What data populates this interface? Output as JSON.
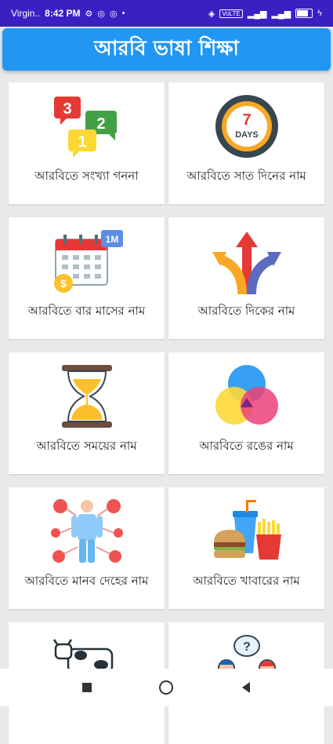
{
  "status_bar": {
    "carrier": "Virgin..",
    "time": "8:42 PM",
    "volte": "VoLTE"
  },
  "app": {
    "title": "আরবি ভাষা শিক্ষা",
    "accent_color": "#2196f3",
    "status_color": "#3a1fc2"
  },
  "cards": [
    {
      "label": "আরবিতে সংখ্যা গননা",
      "icon": "numbers-chat-icon",
      "icon_text": [
        "3",
        "2",
        "1"
      ]
    },
    {
      "label": "আরবিতে সাত দিনের নাম",
      "icon": "seven-days-icon",
      "icon_text": [
        "7",
        "DAYS"
      ]
    },
    {
      "label": "আরবিতে বার মাসের নাম",
      "icon": "calendar-month-icon",
      "icon_text": [
        "1M"
      ]
    },
    {
      "label": "আরবিতে দিকের নাম",
      "icon": "direction-arrows-icon"
    },
    {
      "label": "আরবিতে সময়ের নাম",
      "icon": "hourglass-icon"
    },
    {
      "label": "আরবিতে রঙের নাম",
      "icon": "color-circles-icon"
    },
    {
      "label": "আরবিতে মানব দেহের নাম",
      "icon": "human-body-icon"
    },
    {
      "label": "আরবিতে খাবারের নাম",
      "icon": "food-icon"
    },
    {
      "label": "",
      "icon": "cow-icon"
    },
    {
      "label": "",
      "icon": "people-talking-icon"
    }
  ],
  "nav": {
    "recent": "recent-apps-icon",
    "home": "home-icon",
    "back": "back-icon"
  }
}
